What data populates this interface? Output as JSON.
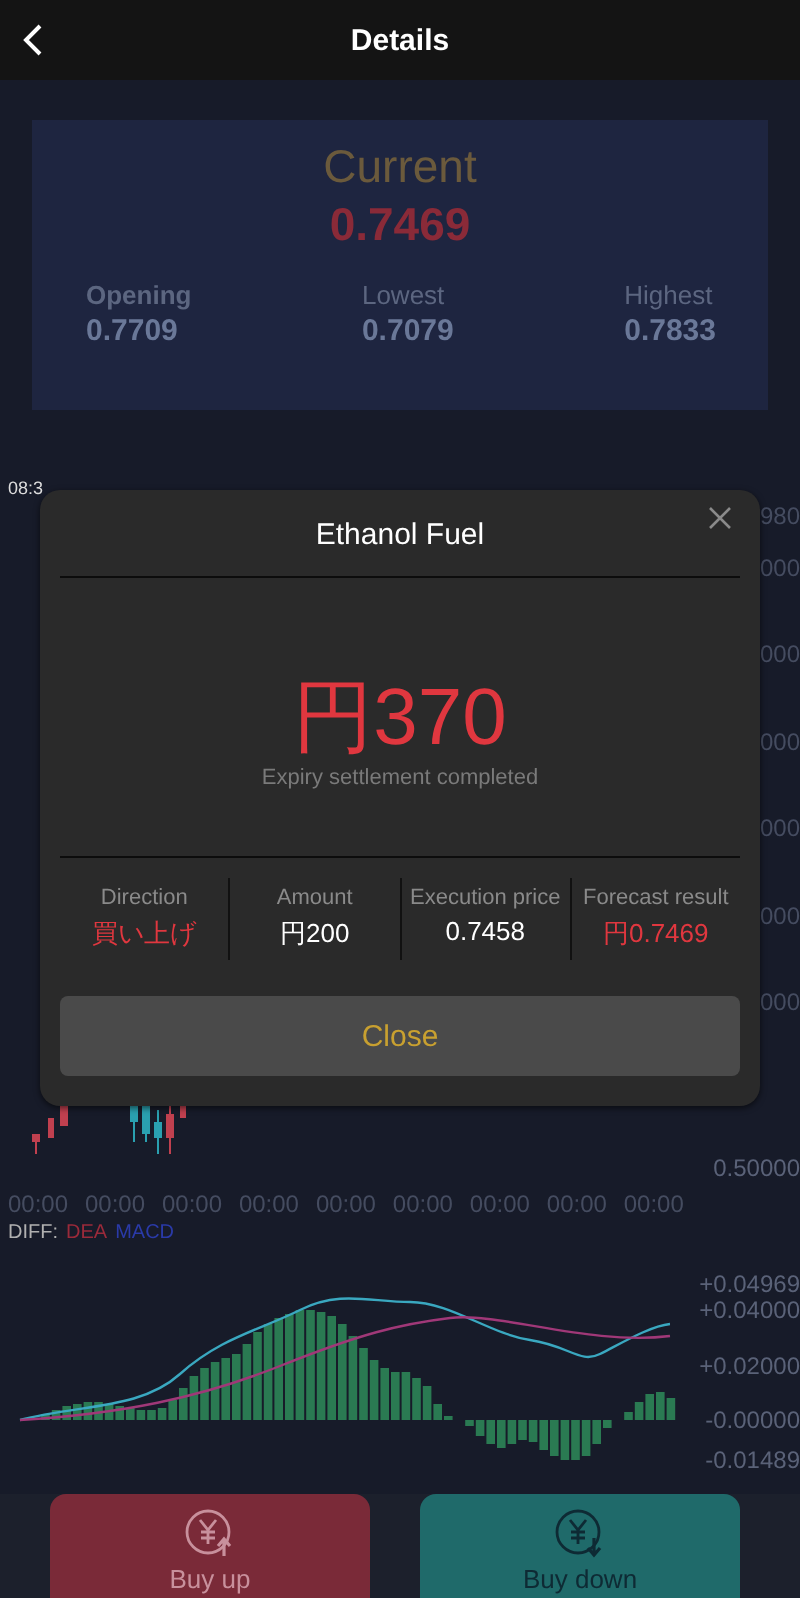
{
  "header": {
    "title": "Details"
  },
  "summary": {
    "label": "Current",
    "value": "0.7469",
    "stats": [
      {
        "label": "Opening",
        "value": "0.7709",
        "emphasized": true
      },
      {
        "label": "Lowest",
        "value": "0.7079",
        "emphasized": false
      },
      {
        "label": "Highest",
        "value": "0.7833",
        "emphasized": false
      }
    ]
  },
  "k_chart": {
    "time_label": "08:3",
    "axis_labels": [
      "980",
      "000",
      "000",
      "000",
      "000",
      "000",
      "000"
    ],
    "bottom_label": "0.50000",
    "times": [
      "00:00",
      "00:00",
      "00:00",
      "00:00",
      "00:00",
      "00:00",
      "00:00",
      "00:00",
      "00:00"
    ]
  },
  "macd": {
    "legend": [
      {
        "text": "DIFF:",
        "color": "#b0b0b0"
      },
      {
        "text": "DEA",
        "color": "#9a2a3a"
      },
      {
        "text": "MACD",
        "color": "#2a3aa8"
      }
    ],
    "axis_labels": [
      "+0.04969",
      "+0.04000",
      "+0.02000",
      "-0.00000",
      "-0.01489"
    ]
  },
  "modal": {
    "title": "Ethanol Fuel",
    "amount": "円370",
    "status": "Expiry settlement completed",
    "details": [
      {
        "label": "Direction",
        "value": "買い上げ",
        "highlight": true
      },
      {
        "label": "Amount",
        "value": "円200",
        "highlight": false
      },
      {
        "label": "Execution price",
        "value": "0.7458",
        "highlight": false
      },
      {
        "label": "Forecast result",
        "value": "円0.7469",
        "highlight": true
      }
    ],
    "close_label": "Close"
  },
  "actions": [
    {
      "label": "Buy up",
      "kind": "up"
    },
    {
      "label": "Buy down",
      "kind": "down"
    }
  ]
}
